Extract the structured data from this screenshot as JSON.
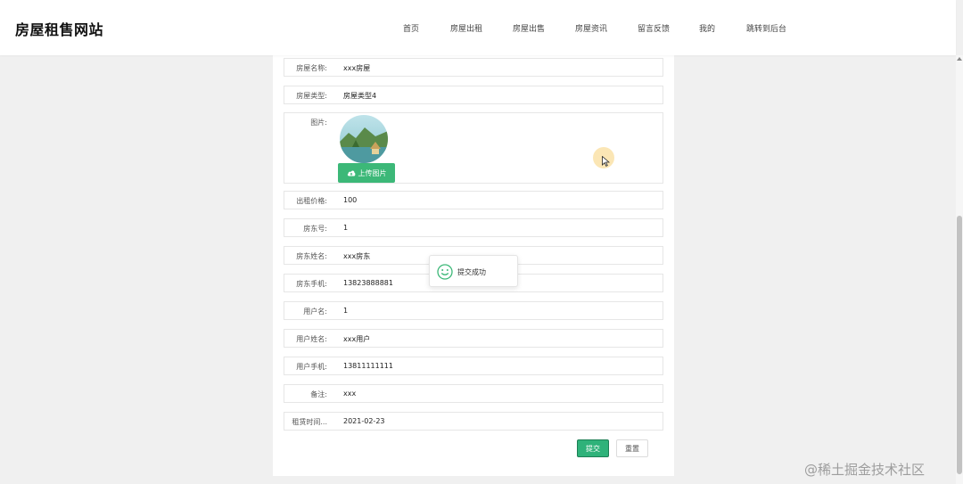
{
  "site": {
    "title": "房屋租售网站"
  },
  "nav": [
    {
      "label": "首页"
    },
    {
      "label": "房屋出租"
    },
    {
      "label": "房屋出售"
    },
    {
      "label": "房屋资讯"
    },
    {
      "label": "留言反馈"
    },
    {
      "label": "我的"
    },
    {
      "label": "跳转到后台"
    }
  ],
  "form": {
    "fields": [
      {
        "label": "房屋名称:",
        "value": "xxx房屋"
      },
      {
        "label": "房屋类型:",
        "value": "房屋类型4"
      },
      {
        "label": "出租价格:",
        "value": "100"
      },
      {
        "label": "房东号:",
        "value": "1"
      },
      {
        "label": "房东姓名:",
        "value": "xxx房东"
      },
      {
        "label": "房东手机:",
        "value": "13823888881"
      },
      {
        "label": "用户名:",
        "value": "1"
      },
      {
        "label": "用户姓名:",
        "value": "xxx用户"
      },
      {
        "label": "用户手机:",
        "value": "13811111111"
      },
      {
        "label": "备注:",
        "value": "xxx"
      },
      {
        "label": "租赁时间...",
        "value": "2021-02-23"
      }
    ],
    "image": {
      "label": "图片:",
      "upload_label": "上传图片",
      "icon": "cloud-upload-icon"
    },
    "submit_label": "提交",
    "reset_label": "重置"
  },
  "toast": {
    "text": "提交成功",
    "icon": "smile-icon"
  },
  "watermark": {
    "text": "@稀土掘金技术社区"
  },
  "colors": {
    "accent": "#3cb878",
    "submit": "#2fb27a",
    "page_bg": "#f0f0f0"
  }
}
